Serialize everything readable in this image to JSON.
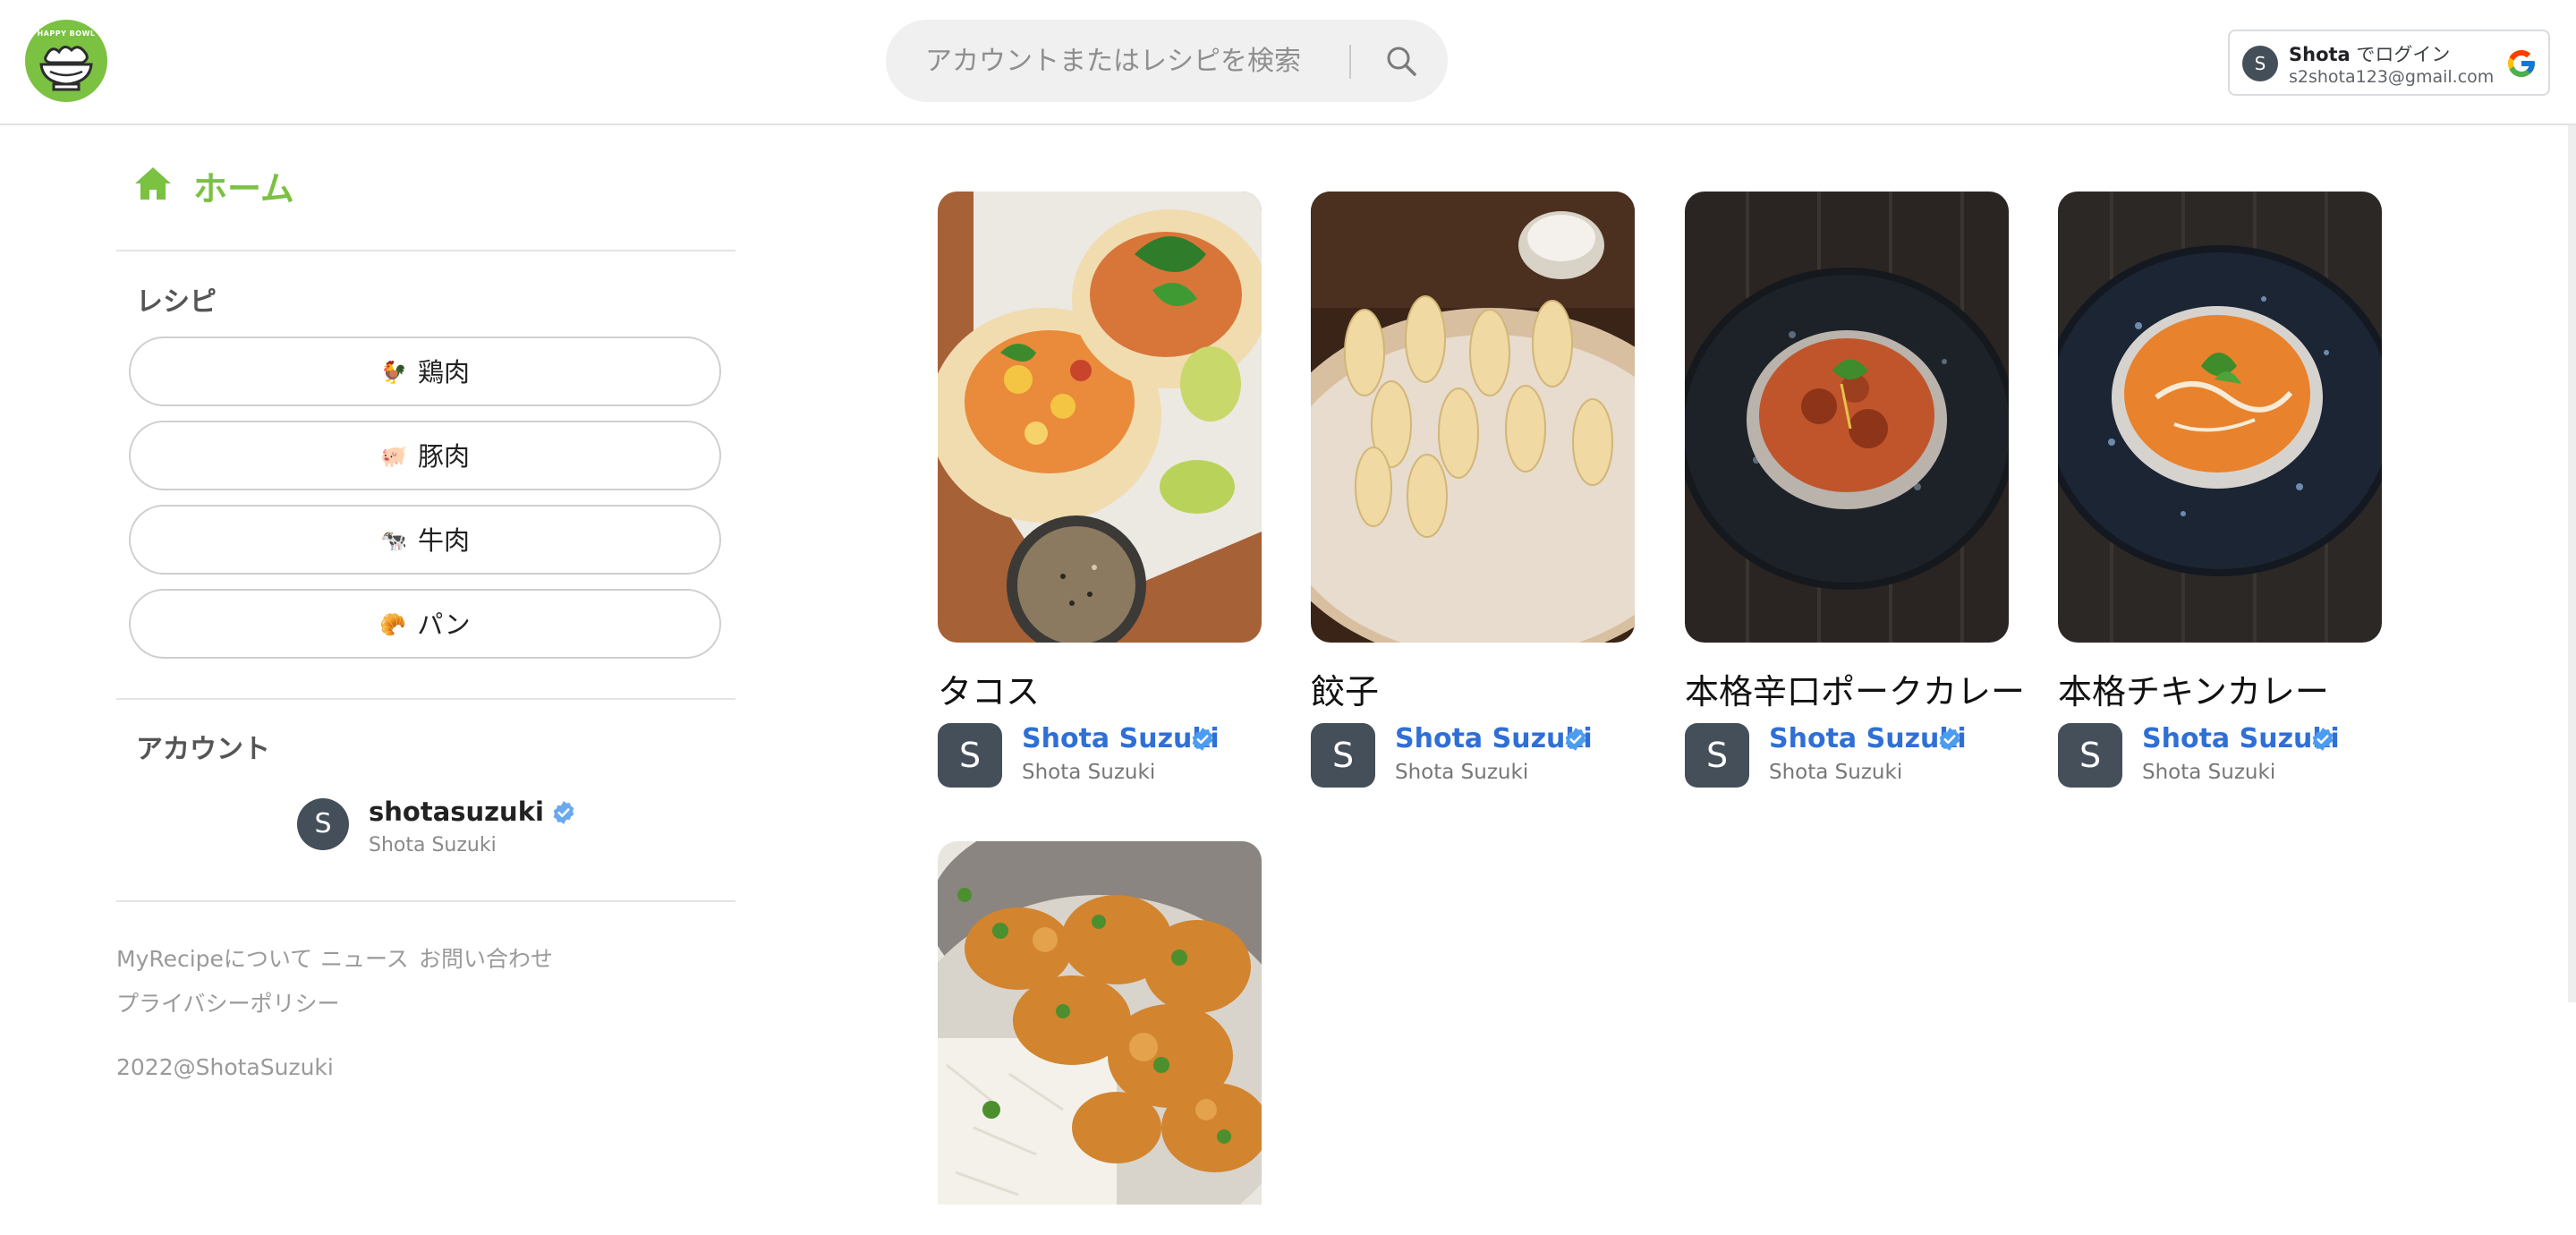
{
  "colors": {
    "brand_green": "#7bc142",
    "link_blue": "#2f6fd6",
    "avatar_gray": "#454f59",
    "verified_blue": "#4c9cf0"
  },
  "header": {
    "logo_text": "HAPPY BOWL",
    "search_placeholder": "アカウントまたはレシピを検索",
    "signin": {
      "avatar_letter": "S",
      "name": "Shota",
      "suffix": " でログイン",
      "email": "s2shota123@gmail.com"
    }
  },
  "sidebar": {
    "home_label": "ホーム",
    "recipe_section_title": "レシピ",
    "categories": [
      {
        "emoji": "🐓",
        "label": "鶏肉"
      },
      {
        "emoji": "🐖",
        "label": "豚肉"
      },
      {
        "emoji": "🐄",
        "label": "牛肉"
      },
      {
        "emoji": "🥐",
        "label": "パン"
      }
    ],
    "account_section_title": "アカウント",
    "account": {
      "avatar_letter": "S",
      "handle": "shotasuzuki",
      "name": "Shota Suzuki"
    },
    "footer_links": [
      "MyRecipeについて",
      "ニュース",
      "お問い合わせ",
      "プライバシーポリシー"
    ],
    "copyright": "2022@ShotaSuzuki"
  },
  "recipes": [
    {
      "title": "タコス",
      "author_letter": "S",
      "author": "Shota Suzuki",
      "author_sub": "Shota Suzuki"
    },
    {
      "title": "餃子",
      "author_letter": "S",
      "author": "Shota Suzuki",
      "author_sub": "Shota Suzuki"
    },
    {
      "title": "本格辛口ポークカレー",
      "author_letter": "S",
      "author": "Shota Suzuki",
      "author_sub": "Shota Suzuki"
    },
    {
      "title": "本格チキンカレー",
      "author_letter": "S",
      "author": "Shota Suzuki",
      "author_sub": "Shota Suzuki"
    },
    {
      "title": "",
      "author_letter": "",
      "author": "",
      "author_sub": ""
    }
  ]
}
